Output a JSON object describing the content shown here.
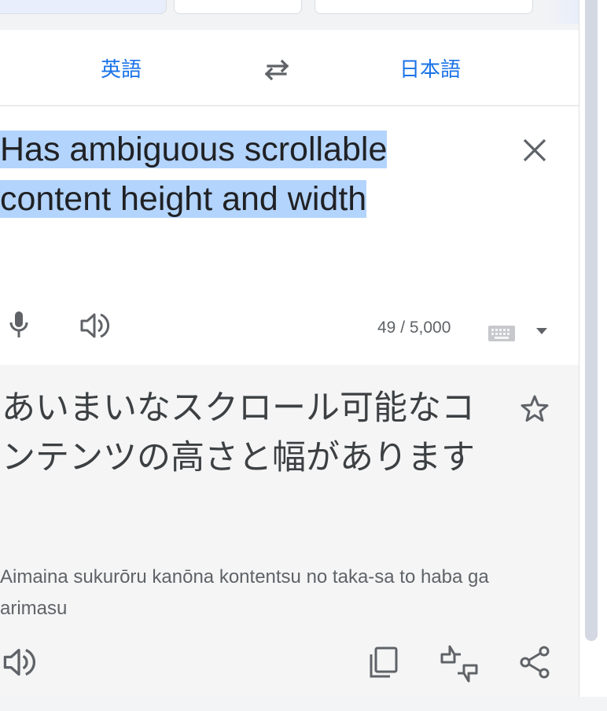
{
  "language_bar": {
    "source_lang": "英語",
    "target_lang": "日本語",
    "swap_icon": "swap-arrows-icon"
  },
  "source": {
    "text_line1": "Has ambiguous scrollable",
    "text_line2": "content height and width",
    "char_count": "49 / 5,000",
    "icons": [
      "mic-icon",
      "speaker-icon",
      "keyboard-icon",
      "chevron-down-icon",
      "close-icon"
    ]
  },
  "translation": {
    "text": "あいまいなスクロール可能なコンテンツの高さと幅があります",
    "romanization": "Aimaina sukurōru kanōna kontentsu no taka-sa to haba ga arimasu",
    "icons": [
      "star-icon",
      "speaker-icon",
      "copy-icon",
      "feedback-icon",
      "share-icon"
    ]
  },
  "colors": {
    "accent": "#1a73e8",
    "selection": "#b3d4fc",
    "target_bg": "#f5f5f5",
    "icon": "#5f6368"
  }
}
